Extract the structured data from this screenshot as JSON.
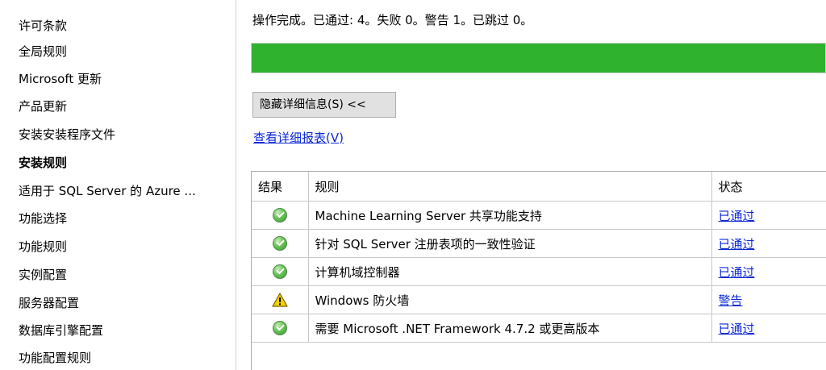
{
  "nav": {
    "items": [
      {
        "label": "许可条款",
        "active": false
      },
      {
        "label": "全局规则",
        "active": false
      },
      {
        "label": "Microsoft 更新",
        "active": false
      },
      {
        "label": "产品更新",
        "active": false
      },
      {
        "label": "安装安装程序文件",
        "active": false
      },
      {
        "label": "安装规则",
        "active": true
      },
      {
        "label": "适用于 SQL Server 的 Azure ...",
        "active": false
      },
      {
        "label": "功能选择",
        "active": false
      },
      {
        "label": "功能规则",
        "active": false
      },
      {
        "label": "实例配置",
        "active": false
      },
      {
        "label": "服务器配置",
        "active": false
      },
      {
        "label": "数据库引擎配置",
        "active": false
      },
      {
        "label": "功能配置规则",
        "active": false
      }
    ]
  },
  "main": {
    "status_text": "操作完成。已通过: 4。失败 0。警告 1。已跳过 0。",
    "progress_percent": 100,
    "progress_color": "#2fb32f",
    "toggle_details_label": "隐藏详细信息(S) <<",
    "view_report_label": "查看详细报表(V)"
  },
  "table": {
    "headers": {
      "result": "结果",
      "rule": "规则",
      "status": "状态"
    },
    "rows": [
      {
        "icon": "check-circle-icon",
        "rule": "Machine Learning Server 共享功能支持",
        "status": "已通过"
      },
      {
        "icon": "check-circle-icon",
        "rule": "针对 SQL Server 注册表项的一致性验证",
        "status": "已通过"
      },
      {
        "icon": "check-circle-icon",
        "rule": "计算机域控制器",
        "status": "已通过"
      },
      {
        "icon": "warning-icon",
        "rule": "Windows 防火墙",
        "status": "警告"
      },
      {
        "icon": "check-circle-icon",
        "rule": "需要 Microsoft .NET Framework 4.7.2 或更高版本",
        "status": "已通过"
      }
    ]
  },
  "colors": {
    "link": "#0b27d6",
    "progress": "#2fb32f"
  }
}
